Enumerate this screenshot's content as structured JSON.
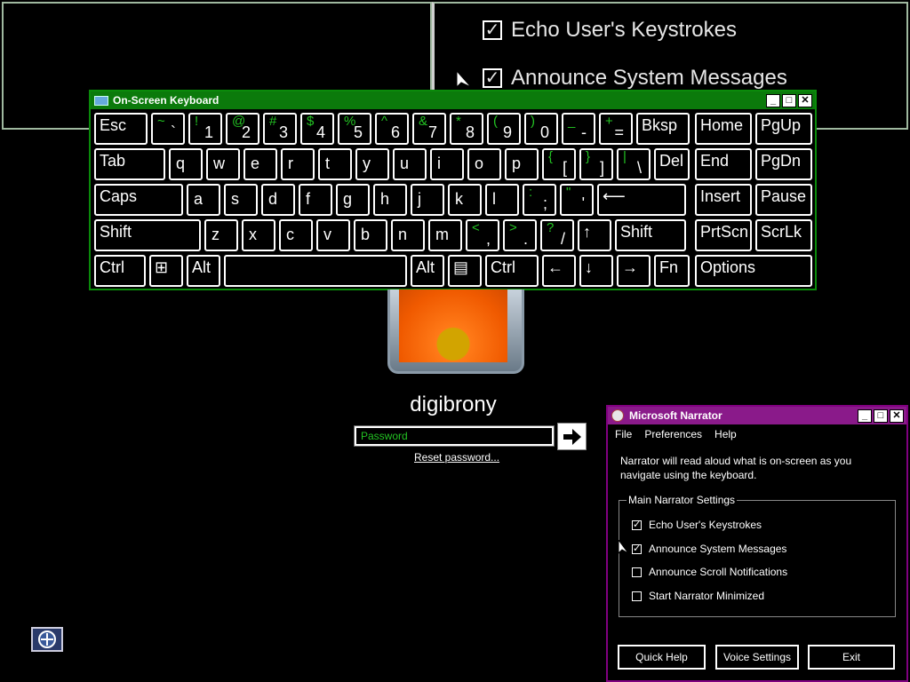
{
  "magnifier": {
    "items": [
      "Echo User's Keystrokes",
      "Announce System Messages"
    ]
  },
  "osk": {
    "title": "On-Screen Keyboard",
    "rows": [
      [
        {
          "t": "Esc"
        },
        {
          "s": "~",
          "l": "`"
        },
        {
          "s": "!",
          "l": "1"
        },
        {
          "s": "@",
          "l": "2"
        },
        {
          "s": "#",
          "l": "3"
        },
        {
          "s": "$",
          "l": "4"
        },
        {
          "s": "%",
          "l": "5"
        },
        {
          "s": "^",
          "l": "6"
        },
        {
          "s": "&",
          "l": "7"
        },
        {
          "s": "*",
          "l": "8"
        },
        {
          "s": "(",
          "l": "9"
        },
        {
          "s": ")",
          "l": "0"
        },
        {
          "s": "_",
          "l": "-"
        },
        {
          "s": "+",
          "l": "="
        },
        {
          "t": "Bksp"
        },
        {
          "t": "Home"
        },
        {
          "t": "PgUp"
        }
      ],
      [
        {
          "t": "Tab"
        },
        {
          "m": "q"
        },
        {
          "m": "w"
        },
        {
          "m": "e"
        },
        {
          "m": "r"
        },
        {
          "m": "t"
        },
        {
          "m": "y"
        },
        {
          "m": "u"
        },
        {
          "m": "i"
        },
        {
          "m": "o"
        },
        {
          "m": "p"
        },
        {
          "s": "{",
          "l": "["
        },
        {
          "s": "}",
          "l": "]"
        },
        {
          "s": "|",
          "l": "\\"
        },
        {
          "t": "Del"
        },
        {
          "t": "End"
        },
        {
          "t": "PgDn"
        }
      ],
      [
        {
          "t": "Caps"
        },
        {
          "m": "a"
        },
        {
          "m": "s"
        },
        {
          "m": "d"
        },
        {
          "m": "f"
        },
        {
          "m": "g"
        },
        {
          "m": "h"
        },
        {
          "m": "j"
        },
        {
          "m": "k"
        },
        {
          "m": "l"
        },
        {
          "s": ":",
          "l": ";"
        },
        {
          "s": "\"",
          "l": "'"
        },
        {
          "t": "⟵"
        },
        {
          "t": "Insert"
        },
        {
          "t": "Pause"
        }
      ],
      [
        {
          "t": "Shift"
        },
        {
          "m": "z"
        },
        {
          "m": "x"
        },
        {
          "m": "c"
        },
        {
          "m": "v"
        },
        {
          "m": "b"
        },
        {
          "m": "n"
        },
        {
          "m": "m"
        },
        {
          "s": "<",
          "l": ","
        },
        {
          "s": ">",
          "l": "."
        },
        {
          "s": "?",
          "l": "/"
        },
        {
          "t": "↑"
        },
        {
          "t": "Shift"
        },
        {
          "t": "PrtScn"
        },
        {
          "t": "ScrLk"
        }
      ],
      [
        {
          "t": "Ctrl"
        },
        {
          "t": "⊞"
        },
        {
          "t": "Alt"
        },
        {
          "t": ""
        },
        {
          "t": "Alt"
        },
        {
          "t": "▤"
        },
        {
          "t": "Ctrl"
        },
        {
          "t": "←"
        },
        {
          "t": "↓"
        },
        {
          "t": "→"
        },
        {
          "t": "Fn"
        },
        {
          "t": "Options"
        }
      ]
    ]
  },
  "logon": {
    "username": "digibrony",
    "password_placeholder": "Password",
    "reset_link": "Reset password..."
  },
  "narrator": {
    "title": "Microsoft  Narrator",
    "menu": [
      "File",
      "Preferences",
      "Help"
    ],
    "description": "Narrator will read aloud what is on-screen as you navigate using the keyboard.",
    "group_label": "Main Narrator Settings",
    "settings": [
      {
        "label": "Echo User's Keystrokes",
        "checked": true
      },
      {
        "label": "Announce System Messages",
        "checked": true
      },
      {
        "label": "Announce Scroll Notifications",
        "checked": false
      },
      {
        "label": "Start Narrator Minimized",
        "checked": false
      }
    ],
    "buttons": [
      "Quick Help",
      "Voice Settings",
      "Exit"
    ]
  },
  "colors": {
    "osk_title": "#0b7a0b",
    "narrator_title": "#8a1a8a",
    "shift_char": "#23c323"
  }
}
